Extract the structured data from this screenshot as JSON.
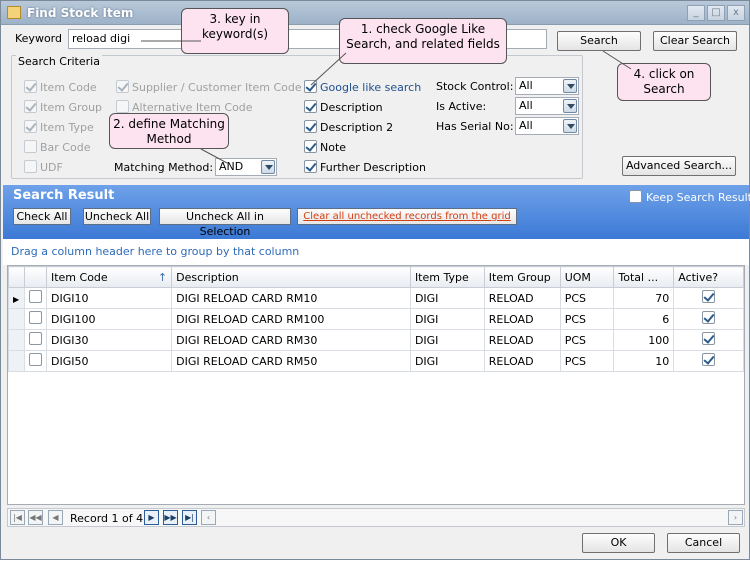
{
  "window": {
    "title": "Find Stock Item",
    "controls": [
      "_",
      "□",
      "x"
    ]
  },
  "keyword": {
    "label": "Keyword",
    "value": "reload digi"
  },
  "buttons": {
    "search": "Search",
    "clear_search": "Clear Search",
    "advanced_search": "Advanced Search...",
    "ok": "OK",
    "cancel": "Cancel"
  },
  "criteria": {
    "title": "Search Criteria",
    "col1": [
      {
        "label": "Item Code",
        "checked": true
      },
      {
        "label": "Item Group",
        "checked": true
      },
      {
        "label": "Item Type",
        "checked": true
      },
      {
        "label": "Bar Code",
        "checked": false
      },
      {
        "label": "UDF",
        "checked": false
      }
    ],
    "col2": [
      {
        "label": "Supplier / Customer Item Code",
        "checked": true
      },
      {
        "label": "Alternative Item Code",
        "checked": false
      }
    ],
    "col3": [
      {
        "label": "Google like search",
        "checked": true
      },
      {
        "label": "Description",
        "checked": true
      },
      {
        "label": "Description 2",
        "checked": true
      },
      {
        "label": "Note",
        "checked": true
      },
      {
        "label": "Further Description",
        "checked": true
      }
    ],
    "matching_label": "Matching Method:",
    "matching_value": "AND",
    "stock_control_label": "Stock Control:",
    "stock_control_value": "All",
    "is_active_label": "Is Active:",
    "is_active_value": "All",
    "serial_label": "Has Serial No:",
    "serial_value": "All"
  },
  "callouts": {
    "c1": "1. check Google Like Search, and related fields",
    "c2": "2. define Matching Method",
    "c3": "3. key in keyword(s)",
    "c4": "4. click on Search"
  },
  "result": {
    "title": "Search Result",
    "keep_label": "Keep Search Result",
    "check_all": "Check All",
    "uncheck_all": "Uncheck All",
    "uncheck_sel": "Uncheck All in Selection",
    "clear_unchecked": "Clear all unchecked records from the grid",
    "groupby": "Drag a column header here to group by that column",
    "columns": [
      "Item Code",
      "Description",
      "Item Type",
      "Item Group",
      "UOM",
      "Total ...",
      "Active?"
    ],
    "rows": [
      {
        "code": "DIGI10",
        "desc": "DIGI RELOAD CARD RM10",
        "type": "DIGI",
        "group": "RELOAD",
        "uom": "PCS",
        "total": "70",
        "active": true
      },
      {
        "code": "DIGI100",
        "desc": "DIGI RELOAD CARD RM100",
        "type": "DIGI",
        "group": "RELOAD",
        "uom": "PCS",
        "total": "6",
        "active": true
      },
      {
        "code": "DIGI30",
        "desc": "DIGI RELOAD CARD RM30",
        "type": "DIGI",
        "group": "RELOAD",
        "uom": "PCS",
        "total": "100",
        "active": true
      },
      {
        "code": "DIGI50",
        "desc": "DIGI RELOAD CARD RM50",
        "type": "DIGI",
        "group": "RELOAD",
        "uom": "PCS",
        "total": "10",
        "active": true
      }
    ],
    "record_text": "Record 1 of 4"
  }
}
